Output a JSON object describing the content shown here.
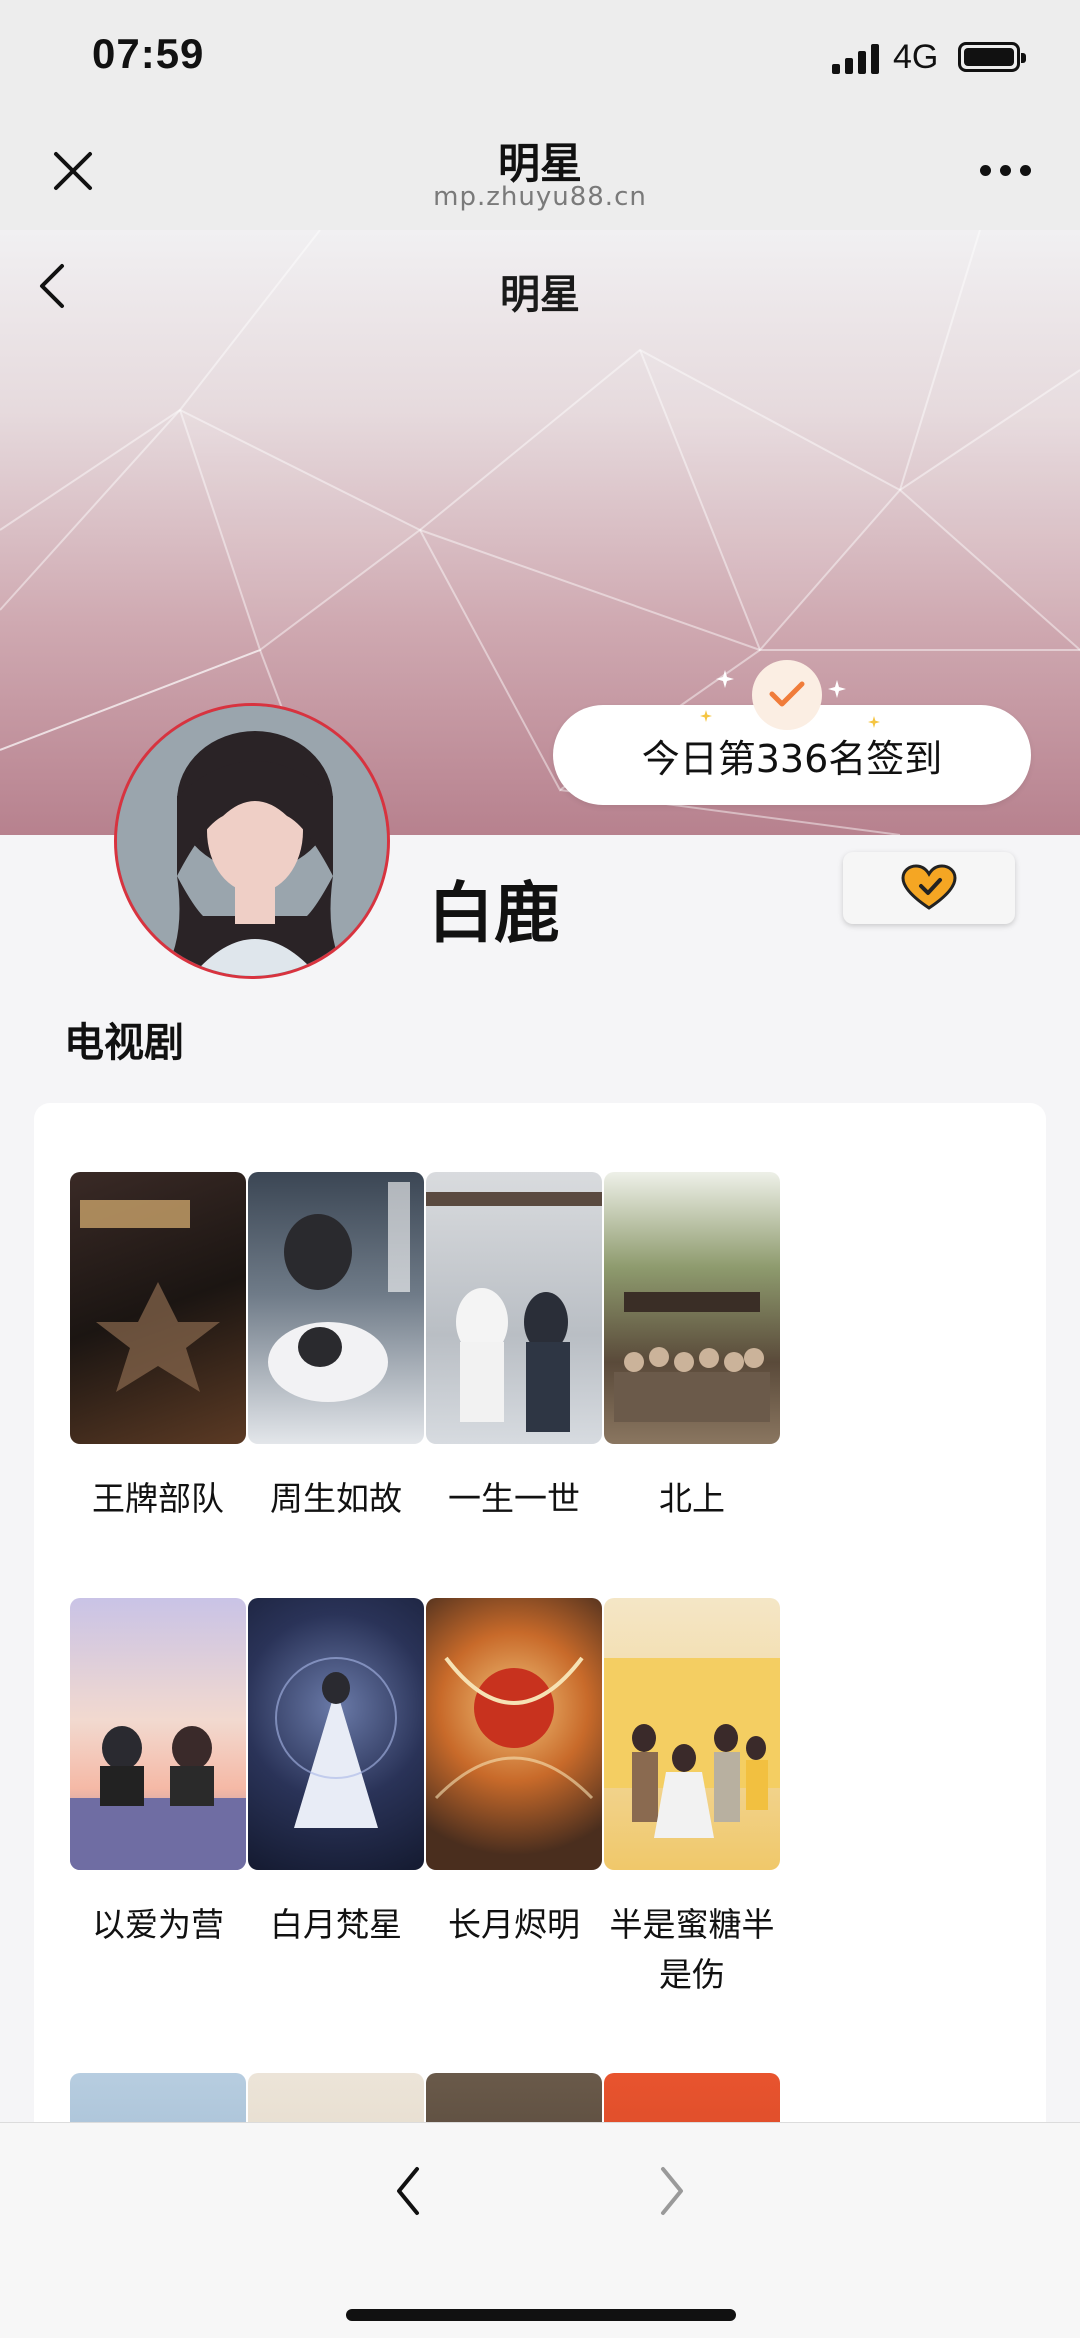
{
  "status_bar": {
    "time": "07:59",
    "network": "4G"
  },
  "browser": {
    "title": "明星",
    "url": "mp.zhuyu88.cn"
  },
  "page": {
    "title": "明星"
  },
  "checkin": {
    "text": "今日第336名签到"
  },
  "star": {
    "name": "白鹿"
  },
  "section": {
    "title": "电视剧"
  },
  "shows": [
    {
      "title": "王牌部队"
    },
    {
      "title": "周生如故"
    },
    {
      "title": "一生一世"
    },
    {
      "title": "北上"
    },
    {
      "title": "以爱为营"
    },
    {
      "title": "白月梵星"
    },
    {
      "title": "长月烬明"
    },
    {
      "title": "半是蜜糖半是伤"
    }
  ],
  "colors": {
    "accent": "#d8333f",
    "checkmark": "#f07c3a",
    "heart": "#f5a623"
  },
  "icons": [
    "close-icon",
    "more-icon",
    "back-icon",
    "check-icon",
    "heart-icon",
    "forward-icon"
  ]
}
